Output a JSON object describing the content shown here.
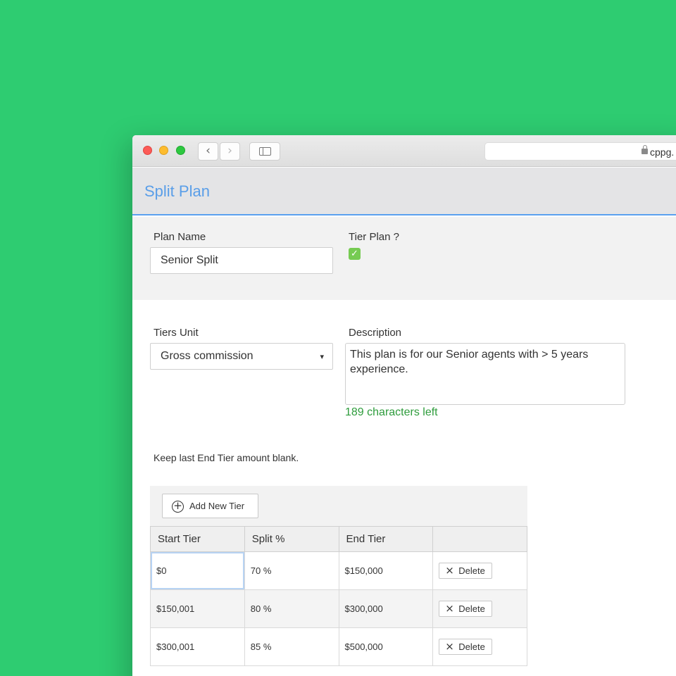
{
  "browser": {
    "url_text": "cppg."
  },
  "page": {
    "title": "Split Plan"
  },
  "form": {
    "plan_name_label": "Plan Name",
    "plan_name_value": "Senior Split",
    "tier_plan_label": "Tier Plan ?",
    "tier_plan_checked": true,
    "tier_plan_check_glyph": "✓",
    "tiers_unit_label": "Tiers Unit",
    "tiers_unit_value": "Gross commission",
    "select_arrow_glyph": "▾",
    "description_label": "Description",
    "description_value": "This plan is for our Senior agents with > 5 years experience.",
    "chars_left": "189 characters left",
    "note": "Keep last End Tier amount blank."
  },
  "tiers": {
    "add_button_label": "Add New Tier",
    "add_icon_glyph": "+",
    "columns": [
      "Start Tier",
      "Split %",
      "End Tier",
      ""
    ],
    "delete_label": "Delete",
    "delete_icon_glyph": "×",
    "rows": [
      {
        "start": "$0",
        "split": "70 %",
        "end": "$150,000"
      },
      {
        "start": "$150,001",
        "split": "80 %",
        "end": "$300,000"
      },
      {
        "start": "$300,001",
        "split": "85 %",
        "end": "$500,000"
      }
    ]
  },
  "colors": {
    "background": "#2ecc71",
    "accent_blue": "#5a9ee8",
    "success_green": "#2e9c3c",
    "checkbox_green": "#76cb52"
  },
  "icons": {
    "back": "chevron-left-icon",
    "forward": "chevron-right-icon",
    "sidebar": "sidebar-icon",
    "lock": "lock-icon",
    "add": "plus-circle-icon",
    "delete": "close-icon"
  }
}
